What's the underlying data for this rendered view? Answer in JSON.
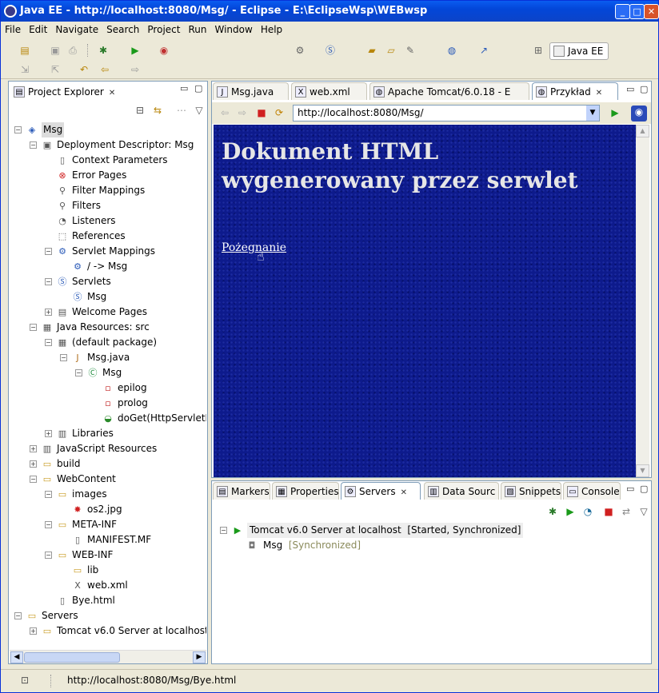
{
  "window": {
    "title": "Java EE - http://localhost:8080/Msg/ - Eclipse - E:\\EclipseWsp\\WEBwsp"
  },
  "menu": [
    "File",
    "Edit",
    "Navigate",
    "Search",
    "Project",
    "Run",
    "Window",
    "Help"
  ],
  "perspective": "Java EE",
  "explorer": {
    "tab": "Project Explorer",
    "tree": [
      {
        "label": "Msg",
        "depth": 0,
        "exp": "-",
        "icon": "project-icon",
        "sel": true
      },
      {
        "label": "Deployment Descriptor: Msg",
        "depth": 1,
        "exp": "-",
        "icon": "descriptor-icon"
      },
      {
        "label": "Context Parameters",
        "depth": 2,
        "icon": "context-params-icon"
      },
      {
        "label": "Error Pages",
        "depth": 2,
        "icon": "error-pages-icon"
      },
      {
        "label": "Filter Mappings",
        "depth": 2,
        "icon": "filter-mappings-icon"
      },
      {
        "label": "Filters",
        "depth": 2,
        "icon": "filters-icon"
      },
      {
        "label": "Listeners",
        "depth": 2,
        "icon": "listeners-icon"
      },
      {
        "label": "References",
        "depth": 2,
        "icon": "references-icon"
      },
      {
        "label": "Servlet Mappings",
        "depth": 2,
        "exp": "-",
        "icon": "servlet-mappings-icon"
      },
      {
        "label": "/ -> Msg",
        "depth": 3,
        "icon": "mapping-icon"
      },
      {
        "label": "Servlets",
        "depth": 2,
        "exp": "-",
        "icon": "servlets-icon"
      },
      {
        "label": "Msg",
        "depth": 3,
        "icon": "servlet-icon"
      },
      {
        "label": "Welcome Pages",
        "depth": 2,
        "exp": "+",
        "icon": "welcome-pages-icon"
      },
      {
        "label": "Java Resources: src",
        "depth": 1,
        "exp": "-",
        "icon": "java-resources-icon"
      },
      {
        "label": "(default package)",
        "depth": 2,
        "exp": "-",
        "icon": "package-icon"
      },
      {
        "label": "Msg.java",
        "depth": 3,
        "exp": "-",
        "icon": "java-file-icon"
      },
      {
        "label": "Msg",
        "depth": 4,
        "exp": "-",
        "icon": "class-icon"
      },
      {
        "label": "epilog",
        "depth": 5,
        "icon": "field-icon"
      },
      {
        "label": "prolog",
        "depth": 5,
        "icon": "field-icon"
      },
      {
        "label": "doGet(HttpServletR",
        "depth": 5,
        "icon": "method-icon"
      },
      {
        "label": "Libraries",
        "depth": 2,
        "exp": "+",
        "icon": "libraries-icon"
      },
      {
        "label": "JavaScript Resources",
        "depth": 1,
        "exp": "+",
        "icon": "js-resources-icon"
      },
      {
        "label": "build",
        "depth": 1,
        "exp": "+",
        "icon": "folder-icon"
      },
      {
        "label": "WebContent",
        "depth": 1,
        "exp": "-",
        "icon": "folder-icon"
      },
      {
        "label": "images",
        "depth": 2,
        "exp": "-",
        "icon": "folder-icon"
      },
      {
        "label": "os2.jpg",
        "depth": 3,
        "icon": "image-file-icon"
      },
      {
        "label": "META-INF",
        "depth": 2,
        "exp": "-",
        "icon": "folder-icon"
      },
      {
        "label": "MANIFEST.MF",
        "depth": 3,
        "icon": "file-icon"
      },
      {
        "label": "WEB-INF",
        "depth": 2,
        "exp": "-",
        "icon": "folder-icon"
      },
      {
        "label": "lib",
        "depth": 3,
        "icon": "folder-icon"
      },
      {
        "label": "web.xml",
        "depth": 3,
        "icon": "xml-file-icon"
      },
      {
        "label": "Bye.html",
        "depth": 2,
        "icon": "file-icon"
      },
      {
        "label": "Servers",
        "depth": 0,
        "exp": "-",
        "icon": "folder-icon"
      },
      {
        "label": "Tomcat v6.0 Server at localhost-",
        "depth": 1,
        "exp": "+",
        "icon": "folder-icon"
      }
    ]
  },
  "editor": {
    "tabs": [
      {
        "label": "Msg.java",
        "icon": "java-file-icon"
      },
      {
        "label": "web.xml",
        "icon": "xml-file-icon"
      },
      {
        "label": "Apache Tomcat/6.0.18 - E",
        "icon": "globe-icon"
      },
      {
        "label": "Przykład",
        "icon": "globe-icon",
        "active": true
      }
    ],
    "url": "http://localhost:8080/Msg/",
    "page": {
      "heading": "Dokument HTML wygenerowany przez serwlet",
      "link": "Pożegnanie"
    }
  },
  "bottom": {
    "tabs": [
      {
        "label": "Markers",
        "icon": "markers-icon"
      },
      {
        "label": "Properties",
        "icon": "properties-icon"
      },
      {
        "label": "Servers",
        "icon": "servers-icon",
        "active": true
      },
      {
        "label": "Data Sourc",
        "icon": "data-source-icon"
      },
      {
        "label": "Snippets",
        "icon": "snippets-icon"
      },
      {
        "label": "Console",
        "icon": "console-icon"
      }
    ],
    "servers": {
      "server": "Tomcat v6.0 Server at localhost",
      "server_state": "[Started, Synchronized]",
      "module": "Msg",
      "module_state": "[Synchronized]"
    }
  },
  "status": {
    "text": "http://localhost:8080/Msg/Bye.html"
  }
}
